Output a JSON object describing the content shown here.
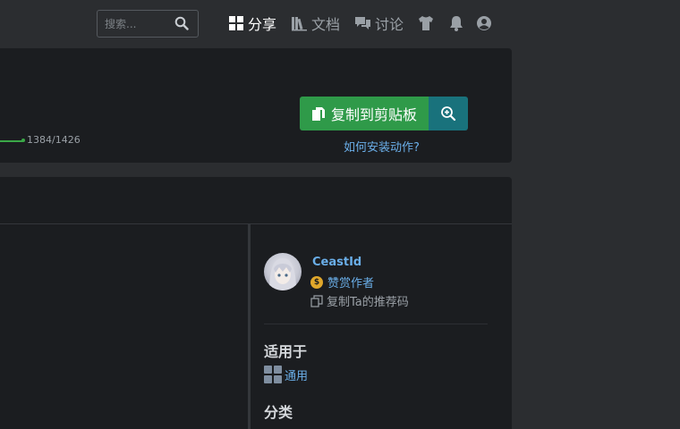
{
  "search": {
    "placeholder": "搜索...",
    "value": ""
  },
  "nav": {
    "share_label": "分享",
    "docs_label": "文档",
    "discuss_label": "讨论"
  },
  "action": {
    "progress_text": "1384/1426",
    "copy_button_label": "复制到剪贴板",
    "install_link": "如何安装动作?"
  },
  "author": {
    "name": "CeastId",
    "reward_label": "赞赏作者",
    "coin_symbol": "$",
    "referral_label": "复制Ta的推荐码"
  },
  "sidebar": {
    "applies_title": "适用于",
    "applies_item": "通用",
    "category_title": "分类"
  },
  "colors": {
    "accent_green": "#2f9a49",
    "accent_teal": "#19727c",
    "link_blue": "#6aaee8",
    "progress_green": "#3aa847"
  },
  "icons": {
    "share": "grid-icon",
    "docs": "books-icon",
    "discuss": "chat-icon",
    "shirt": "shirt-icon",
    "bell": "bell-icon",
    "user": "user-circle-icon",
    "search": "search-icon",
    "clipboard": "clipboard-icon",
    "zoom": "zoom-in-icon",
    "copy": "copy-icon"
  }
}
